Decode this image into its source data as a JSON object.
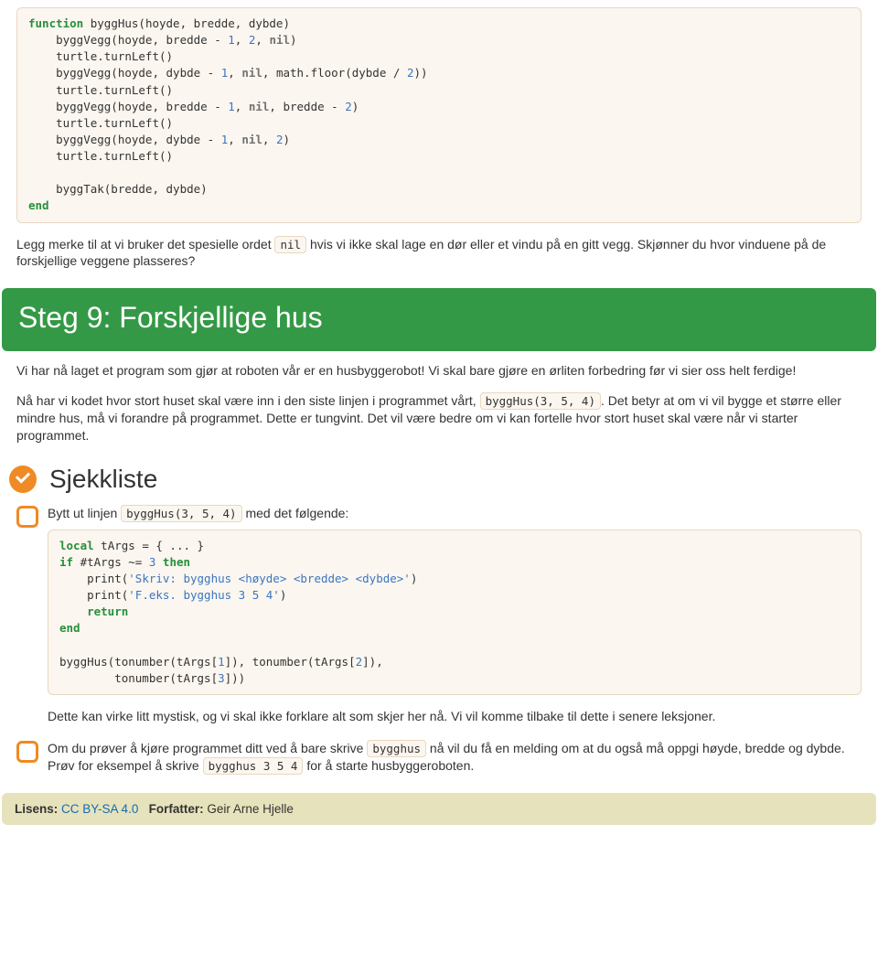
{
  "codeblock1_html": "<span class=\"tok-kw\">function</span> byggHus(hoyde, bredde, dybde)\n    byggVegg(hoyde, bredde - <span class=\"tok-num\">1</span>, <span class=\"tok-num\">2</span>, <span class=\"tok-nil\">nil</span>)\n    turtle.turnLeft()\n    byggVegg(hoyde, dybde - <span class=\"tok-num\">1</span>, <span class=\"tok-nil\">nil</span>, math.floor(dybde / <span class=\"tok-num\">2</span>))\n    turtle.turnLeft()\n    byggVegg(hoyde, bredde - <span class=\"tok-num\">1</span>, <span class=\"tok-nil\">nil</span>, bredde - <span class=\"tok-num\">2</span>)\n    turtle.turnLeft()\n    byggVegg(hoyde, dybde - <span class=\"tok-num\">1</span>, <span class=\"tok-nil\">nil</span>, <span class=\"tok-num\">2</span>)\n    turtle.turnLeft()\n\n    byggTak(bredde, dybde)\n<span class=\"tok-kw\">end</span>",
  "para1_before": "Legg merke til at vi bruker det spesielle ordet ",
  "para1_code": "nil",
  "para1_after": " hvis vi ikke skal lage en dør eller et vindu på en gitt vegg. Skjønner du hvor vinduene på de forskjellige veggene plasseres?",
  "step_title": "Steg 9: Forskjellige hus",
  "para2": "Vi har nå laget et program som gjør at roboten vår er en husbyggerobot! Vi skal bare gjøre en ørliten forbedring før vi sier oss helt ferdige!",
  "para3_before": "Nå har vi kodet hvor stort huset skal være inn i den siste linjen i programmet vårt, ",
  "para3_code": "byggHus(3, 5, 4)",
  "para3_after": ". Det betyr at om vi vil bygge et større eller mindre hus, må vi forandre på programmet. Dette er tungvint. Det vil være bedre om vi kan fortelle hvor stort huset skal være når vi starter programmet.",
  "checklist_title": "Sjekkliste",
  "check1_before": "Bytt ut linjen ",
  "check1_code": "byggHus(3, 5, 4)",
  "check1_after": " med det følgende:",
  "codeblock2_html": "<span class=\"tok-kw\">local</span> tArgs = { ... }\n<span class=\"tok-kw\">if</span> #tArgs ~= <span class=\"tok-num\">3</span> <span class=\"tok-kw\">then</span>\n    print(<span class=\"tok-str\">'Skriv: bygghus &lt;høyde&gt; &lt;bredde&gt; &lt;dybde&gt;'</span>)\n    print(<span class=\"tok-str\">'F.eks. bygghus 3 5 4'</span>)\n    <span class=\"tok-kw\">return</span>\n<span class=\"tok-kw\">end</span>\n\nbyggHus(tonumber(tArgs[<span class=\"tok-num\">1</span>]), tonumber(tArgs[<span class=\"tok-num\">2</span>]),\n        tonumber(tArgs[<span class=\"tok-num\">3</span>]))",
  "check1_para2": "Dette kan virke litt mystisk, og vi skal ikke forklare alt som skjer her nå. Vi vil komme tilbake til dette i senere leksjoner.",
  "check2_before": "Om du prøver å kjøre programmet ditt ved å bare skrive ",
  "check2_code1": "bygghus",
  "check2_mid": " nå vil du få en melding om at du også må oppgi høyde, bredde og dybde. Prøv for eksempel å skrive ",
  "check2_code2": "bygghus 3 5 4",
  "check2_after": " for å starte husbyggeroboten.",
  "footer": {
    "license_label": "Lisens:",
    "license_link": "CC BY-SA 4.0",
    "author_label": "Forfatter:",
    "author_name": "Geir Arne Hjelle"
  }
}
